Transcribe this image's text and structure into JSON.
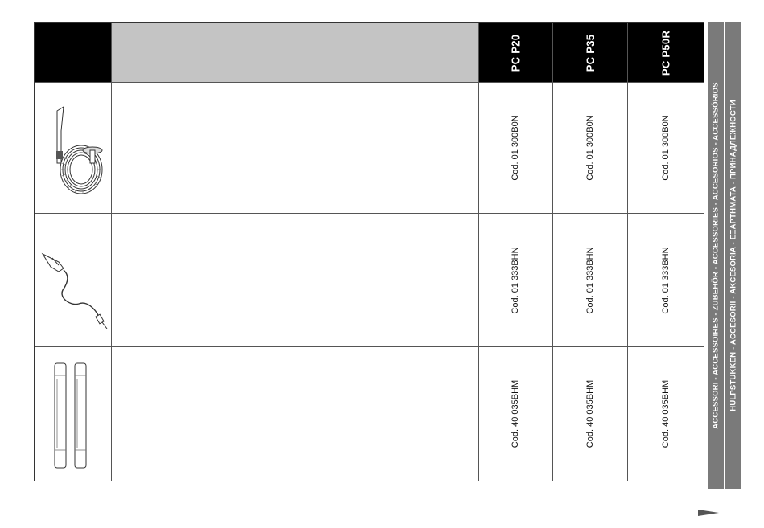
{
  "header": {
    "models": [
      "PC P20",
      "PC P35",
      "PC P50R"
    ]
  },
  "rows": [
    {
      "image_name": "hose-with-handle",
      "codes": [
        "Cod. 01 300B0N",
        "Cod. 01 300B0N",
        "Cod. 01 300B0N"
      ]
    },
    {
      "image_name": "electric-cable-with-plug",
      "codes": [
        "Cod. 01 333BHN",
        "Cod. 01 333BHN",
        "Cod. 01 333BHN"
      ]
    },
    {
      "image_name": "extension-tubes",
      "codes": [
        "Cod. 40 035BHM",
        "Cod. 40 035BHM",
        "Cod. 40 035BHM"
      ]
    }
  ],
  "side_banner": {
    "line1": "ACCESSORI - ACCESSOIRES - ZUBEHÖR - ACCESSORIES - ACCESORIOS - ACCESSÓRIOS",
    "line2": "HULPSTUKKEN - ACCESORII - AKCESORIA - ΕΞΑΡΤΗΜΑΤΑ - ПРИНАДЛЕЖНОСТИ"
  }
}
